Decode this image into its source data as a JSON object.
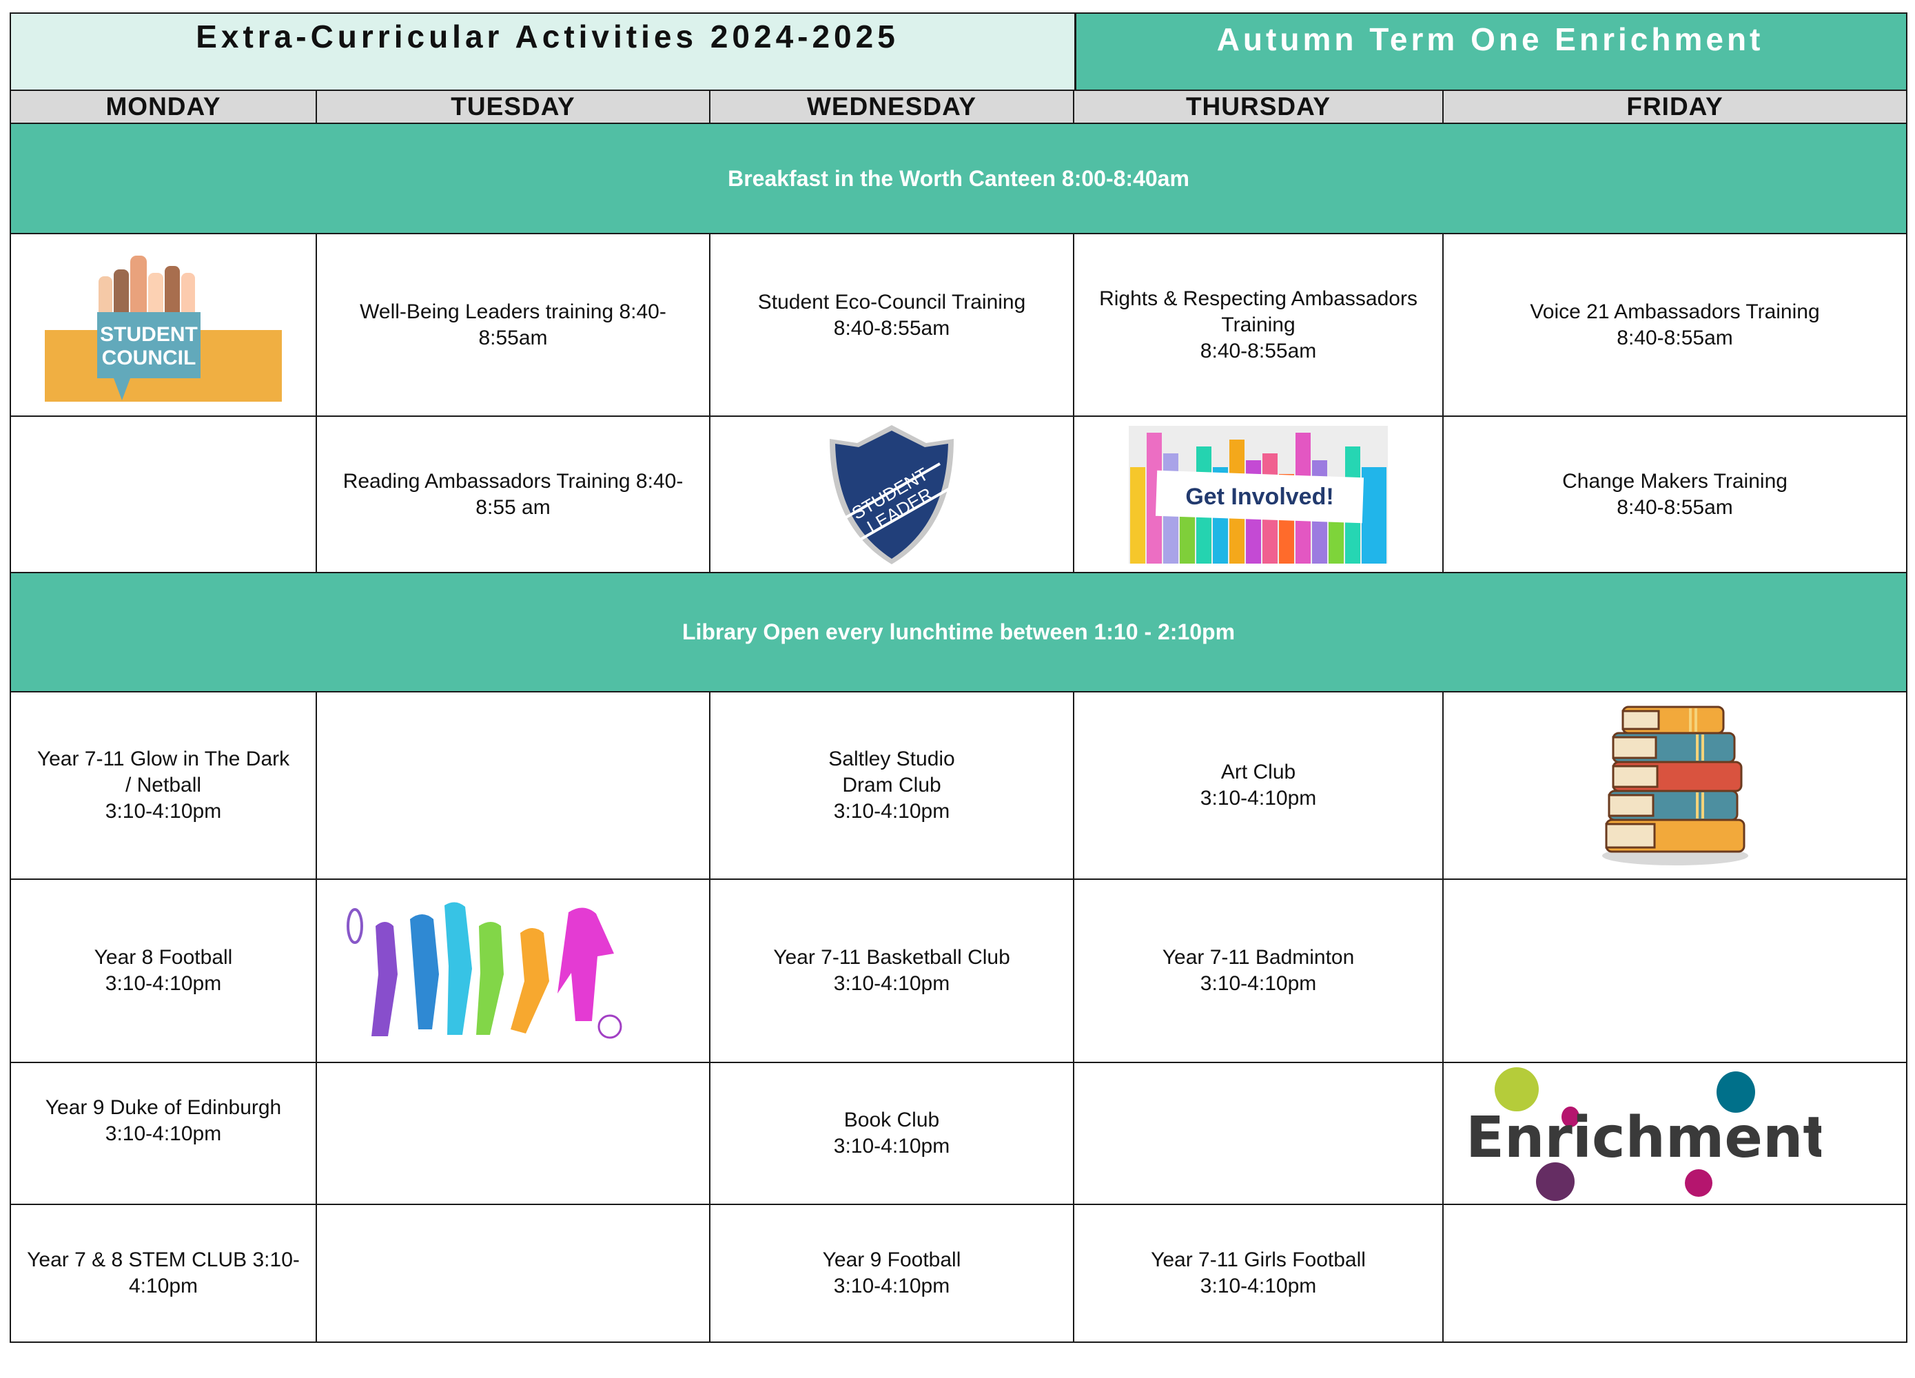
{
  "header": {
    "title": "Extra-Curricular Activities 2024-2025",
    "term": "Autumn Term One Enrichment"
  },
  "days": [
    "MONDAY",
    "TUESDAY",
    "WEDNESDAY",
    "THURSDAY",
    "FRIDAY"
  ],
  "bands": {
    "breakfast": "Breakfast in the Worth Canteen 8:00-8:40am",
    "lunch": "Library Open every lunchtime between 1:10 - 2:10pm"
  },
  "morning": {
    "row1": {
      "monday_image": "student-council-logo",
      "student_council_text": [
        "STUDENT",
        "COUNCIL"
      ],
      "tuesday": [
        "Well-Being Leaders training 8:40-",
        "8:55am"
      ],
      "wednesday": [
        "Student Eco-Council Training",
        "8:40-8:55am"
      ],
      "thursday": [
        "Rights & Respecting Ambassadors",
        "Training",
        "8:40-8:55am"
      ],
      "friday": [
        "Voice 21 Ambassadors Training",
        "8:40-8:55am"
      ]
    },
    "row2": {
      "tuesday": [
        "Reading Ambassadors Training 8:40-",
        "8:55 am"
      ],
      "wednesday_image": "student-leader-badge",
      "badge_text": [
        "STUDENT",
        "LEADER"
      ],
      "thursday_image": "get-involved-hands",
      "get_involved_text": "Get Involved!",
      "friday": [
        "Change Makers Training",
        "8:40-8:55am"
      ]
    }
  },
  "afternoon": {
    "row3": {
      "monday": [
        "Year 7-11 Glow in The Dark",
        "/ Netball",
        "3:10-4:10pm"
      ],
      "wednesday": [
        "Saltley Studio",
        "Dram Club",
        "3:10-4:10pm"
      ],
      "thursday": [
        "Art Club",
        "3:10-4:10pm"
      ],
      "friday_image": "stack-of-books"
    },
    "row4": {
      "monday": [
        "Year 8 Football",
        "3:10-4:10pm"
      ],
      "tuesday_image": "sports-silhouettes",
      "wednesday": [
        "Year 7-11 Basketball Club",
        "3:10-4:10pm"
      ],
      "thursday": [
        "Year 7-11 Badminton",
        "3:10-4:10pm"
      ]
    },
    "row5": {
      "monday": [
        "Year 9 Duke of Edinburgh",
        "3:10-4:10pm"
      ],
      "wednesday": [
        "Book Club",
        "3:10-4:10pm"
      ],
      "friday_image": "enrichment-logo",
      "enrichment_text": "Enrichment"
    },
    "row6": {
      "monday": [
        "Year 7 & 8 STEM CLUB 3:10-",
        "4:10pm"
      ],
      "wednesday": [
        "Year 9 Football",
        "3:10-4:10pm"
      ],
      "thursday": [
        "Year 7-11 Girls Football",
        "3:10-4:10pm"
      ]
    }
  },
  "colors": {
    "teal": "#51BFA4",
    "mint": "#DCF2EC",
    "day_header_gray": "#D9D9D9"
  }
}
